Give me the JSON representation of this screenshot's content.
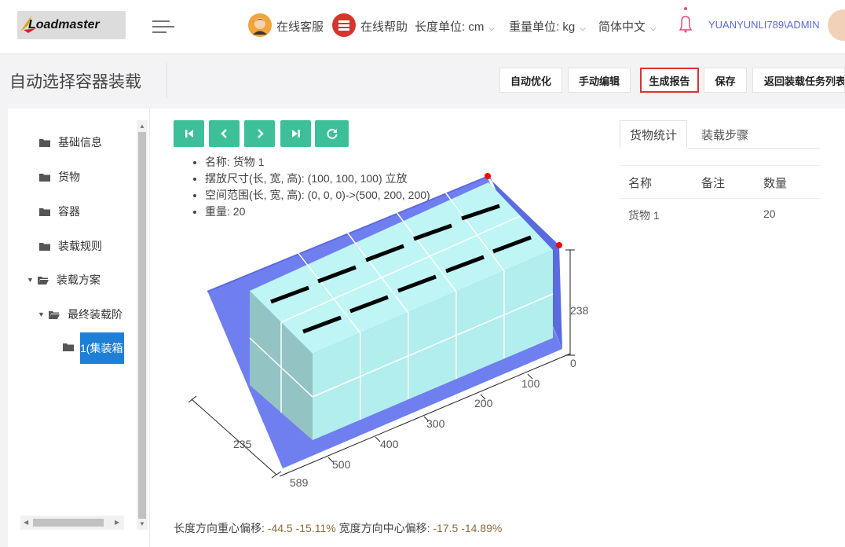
{
  "brand": {
    "logo_text": "Loadmaster"
  },
  "topbar": {
    "support_label": "在线客服",
    "help_label": "在线帮助",
    "length_unit_label": "长度单位: cm",
    "weight_unit_label": "重量单位: kg",
    "language_label": "简体中文",
    "user_label": "YUANYUNLI789\\ADMIN"
  },
  "page": {
    "title": "自动选择容器装载"
  },
  "toolbar": {
    "auto_optimize": "自动优化",
    "manual_edit": "手动编辑",
    "generate_report": "生成报告",
    "save": "保存",
    "back_to_list": "返回装载任务列表"
  },
  "tree": {
    "items": [
      {
        "label": "基础信息"
      },
      {
        "label": "货物"
      },
      {
        "label": "容器"
      },
      {
        "label": "装载规则"
      },
      {
        "label": "装载方案"
      },
      {
        "label": "最终装载阶"
      },
      {
        "label": "1(集装箱"
      }
    ]
  },
  "controls": {
    "icons": [
      "first-icon",
      "prev-icon",
      "next-icon",
      "last-icon",
      "refresh-icon"
    ]
  },
  "info": {
    "name": "名称: 货物 1",
    "size": "摆放尺寸(长, 宽, 高): (100, 100, 100) 立放",
    "space": "空间范围(长, 宽, 高): (0, 0, 0)->(500, 200, 200)",
    "weight": "重量: 20"
  },
  "scene": {
    "axis_labels": {
      "height_max": "238",
      "height_min": "0",
      "len_100": "100",
      "len_200": "200",
      "len_300": "300",
      "len_400": "400",
      "len_500": "500",
      "len_589": "589",
      "width_235": "235"
    },
    "colors": {
      "container_floor": "#6f7ff0",
      "container_wall": "#5a6be0",
      "cargo_top": "#bff5f5",
      "cargo_front": "#b2eeee",
      "cargo_side": "#93c3c3",
      "marker": "#ff0000"
    }
  },
  "offset": {
    "length_label": "长度方向重心偏移: ",
    "length_value": "-44.5",
    "length_pct": "-15.11%",
    "width_label": " 宽度方向中心偏移: ",
    "width_value": "-17.5",
    "width_pct": "-14.89%"
  },
  "stats": {
    "tabs": [
      "货物统计",
      "装载步骤"
    ],
    "headers": [
      "名称",
      "备注",
      "数量"
    ],
    "rows": [
      {
        "name": "货物 1",
        "note": "",
        "qty": "20"
      }
    ]
  }
}
